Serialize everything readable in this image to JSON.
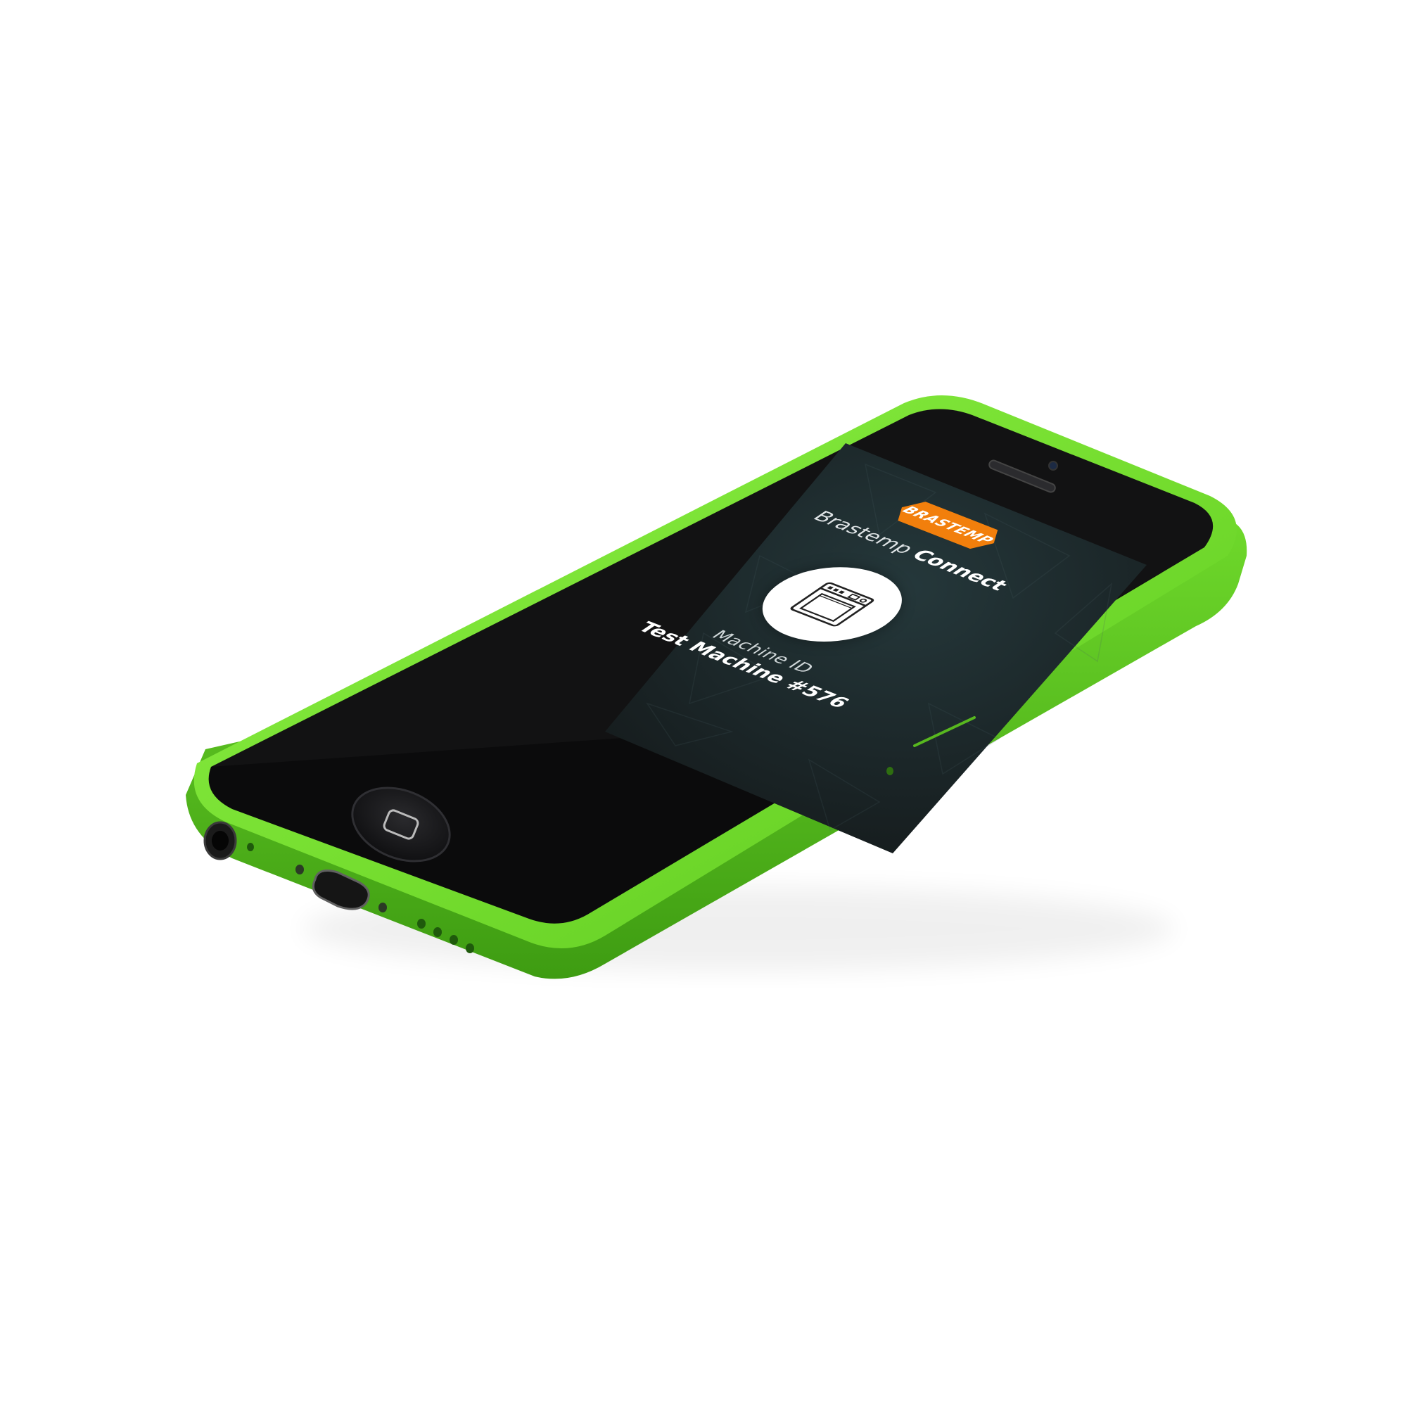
{
  "app": {
    "brand_badge": "BRASTEMP",
    "title_light": "Brastemp",
    "title_bold": "Connect",
    "machine_id_label": "Machine ID",
    "machine_name": "Test Machine #576"
  },
  "icons": {
    "brand": "brastemp-logo-icon",
    "appliance": "oven-appliance-icon",
    "home_button": "home-button-icon"
  },
  "colors": {
    "phone_body": "#7fe23a",
    "phone_body_dark": "#4fb11c",
    "bezel": "#0b0b0c",
    "screen_bg": "#1d2a2d",
    "brand_orange": "#f27f0c",
    "text_white": "#ffffff"
  }
}
